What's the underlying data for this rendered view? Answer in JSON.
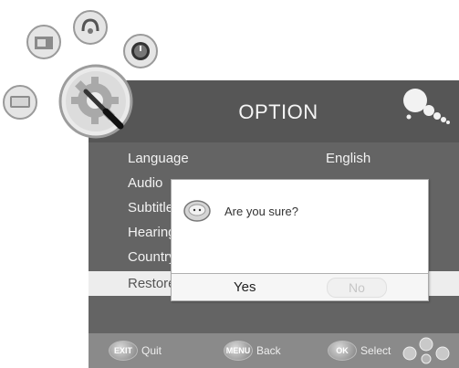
{
  "menu": {
    "title": "OPTION",
    "items": [
      {
        "label": "Language",
        "value": "English"
      },
      {
        "label": "Audio",
        "value": ""
      },
      {
        "label": "Subtitle",
        "value": ""
      },
      {
        "label": "Hearing",
        "value": ""
      },
      {
        "label": "Country",
        "value": ""
      },
      {
        "label": "Restore Factory",
        "value": ""
      }
    ],
    "selected_index": 5
  },
  "dialog": {
    "message": "Are you sure?",
    "yes_label": "Yes",
    "no_label": "No"
  },
  "footer": {
    "exit_key": "EXIT",
    "exit_label": "Quit",
    "menu_key": "MENU",
    "menu_label": "Back",
    "ok_key": "OK",
    "ok_label": "Select"
  },
  "icons": [
    "picture-icon",
    "sound-icon",
    "channel-icon",
    "time-icon",
    "lock-icon",
    "option-gear-icon",
    "bubbles-logo-icon",
    "nav-arrows-icon",
    "dialog-face-icon"
  ],
  "colors": {
    "panel": "#646464",
    "highlight": "#ededed",
    "footer": "#8a8a8a"
  }
}
